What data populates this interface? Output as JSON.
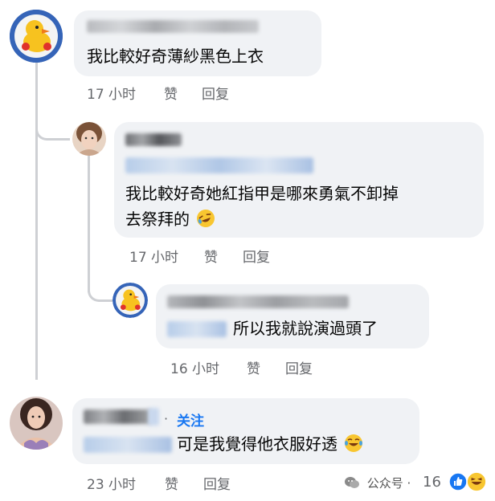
{
  "comments": [
    {
      "text": "我比較好奇薄紗黑色上衣",
      "time": "17 小时",
      "like": "赞",
      "reply": "回复"
    },
    {
      "text_line1": "我比較好奇她紅指甲是哪來勇氣不卸掉",
      "text_line2": "去祭拜的",
      "time": "17 小时",
      "like": "赞",
      "reply": "回复"
    },
    {
      "text": "所以我就說演過頭了",
      "time": "16 小时",
      "like": "赞",
      "reply": "回复"
    },
    {
      "follow": "关注",
      "text": "可是我覺得他衣服好透",
      "time": "23 小时",
      "like": "赞",
      "reply": "回复"
    }
  ],
  "watermark": {
    "text": "公众号 · ",
    "reaction_count": "16",
    "icon": "wechat-icon"
  },
  "colors": {
    "bubble": "#f0f2f5",
    "meta": "#65676b",
    "link": "#1877f2",
    "thread": "#ced0d4"
  }
}
